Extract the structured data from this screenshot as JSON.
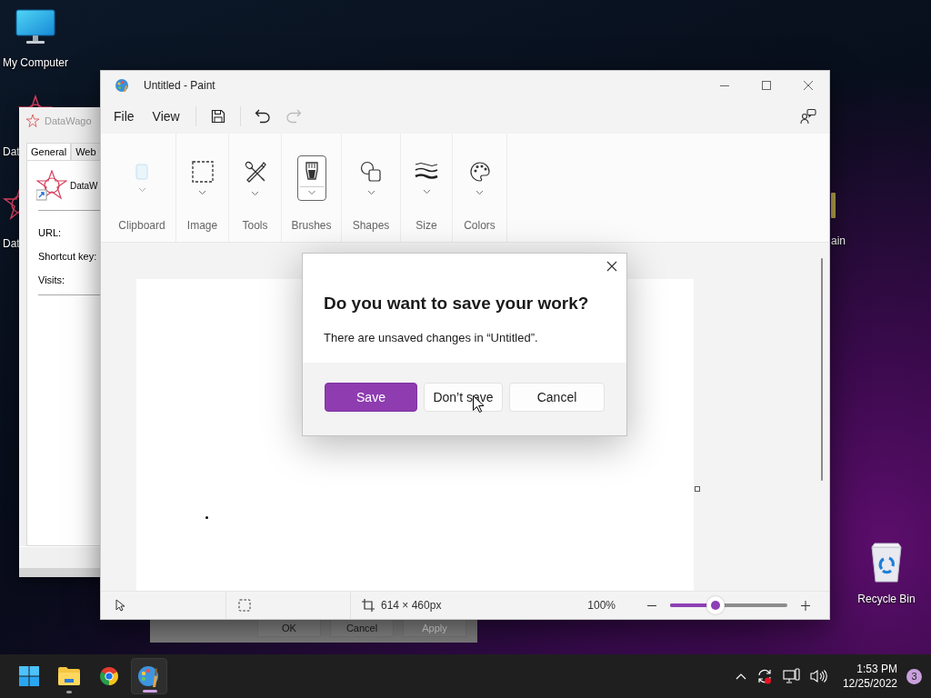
{
  "desktop_icons": [
    {
      "kind": "computer",
      "label": "My Computer"
    },
    {
      "kind": "app",
      "label": "Dat"
    },
    {
      "kind": "app",
      "label": "Dat"
    },
    {
      "kind": "folder",
      "label": "ain"
    },
    {
      "kind": "recycle",
      "label": "Recycle Bin"
    }
  ],
  "properties_window": {
    "title": "DataWago",
    "tabs": [
      {
        "label": "General",
        "selected": true
      },
      {
        "label": "Web",
        "selected": false
      }
    ],
    "app_name": "DataW",
    "fields": [
      {
        "label": "URL:"
      },
      {
        "label": "Shortcut key:"
      },
      {
        "label": "Visits:"
      }
    ]
  },
  "back_dialog": {
    "buttons": [
      {
        "label": "OK",
        "disabled": false
      },
      {
        "label": "Cancel",
        "disabled": false
      },
      {
        "label": "Apply",
        "disabled": true
      }
    ]
  },
  "paint": {
    "title": "Untitled - Paint",
    "menu": [
      "File",
      "View"
    ],
    "quick_actions": [
      {
        "kind": "save",
        "disabled": false
      },
      {
        "kind": "undo",
        "disabled": false
      },
      {
        "kind": "redo",
        "disabled": true
      }
    ],
    "ribbon": [
      {
        "kind": "clipboard",
        "label": "Clipboard",
        "selected": false,
        "disabled": true
      },
      {
        "kind": "image",
        "label": "Image",
        "selected": false,
        "disabled": false
      },
      {
        "kind": "tools",
        "label": "Tools",
        "selected": false,
        "disabled": false
      },
      {
        "kind": "brushes",
        "label": "Brushes",
        "selected": true,
        "disabled": false
      },
      {
        "kind": "shapes",
        "label": "Shapes",
        "selected": false,
        "disabled": false
      },
      {
        "kind": "size",
        "label": "Size",
        "selected": false,
        "disabled": false
      },
      {
        "kind": "colors",
        "label": "Colors",
        "selected": false,
        "disabled": false
      }
    ],
    "status_bar": {
      "canvas_size": "614 × 460px",
      "zoom": "100%",
      "zoom_slider": {
        "level": 0.39
      }
    }
  },
  "dialog": {
    "title": "Do you want to save your work?",
    "message": "There are unsaved changes in “Untitled”.",
    "buttons": [
      {
        "kind": "primary",
        "label": "Save"
      },
      {
        "kind": "secondary",
        "label": "Don’t save"
      },
      {
        "kind": "secondary",
        "label": "Cancel"
      }
    ]
  },
  "taskbar": {
    "apps": [
      {
        "kind": "start",
        "selected": false,
        "running": false
      },
      {
        "kind": "explorer",
        "selected": false,
        "running": true
      },
      {
        "kind": "chrome",
        "selected": false,
        "running": false
      },
      {
        "kind": "paint",
        "selected": true,
        "running": true
      }
    ],
    "tray": {
      "time": "1:53 PM",
      "date": "12/25/2022",
      "notifications": "3"
    }
  }
}
